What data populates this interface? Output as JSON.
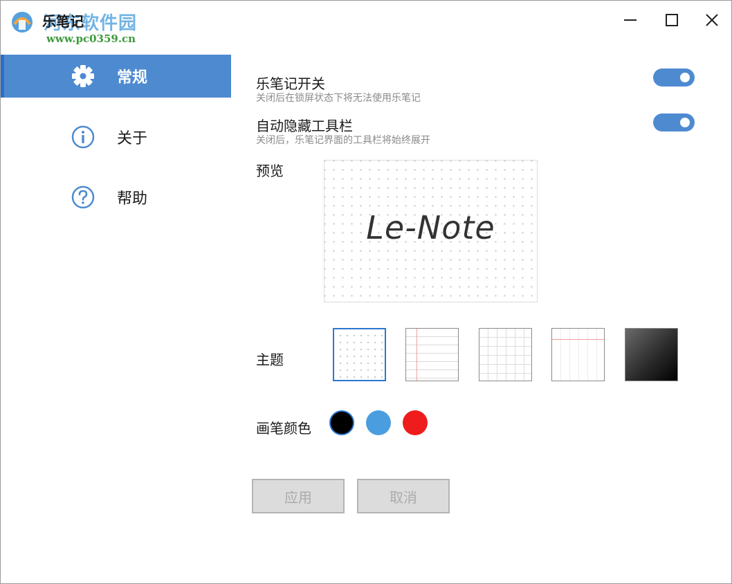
{
  "window": {
    "title": "乐笔记",
    "watermark": {
      "brand": "河东软件园",
      "url": "www.pc0359.cn"
    }
  },
  "sidebar": {
    "items": [
      {
        "label": "常规",
        "icon": "gear-icon",
        "active": true
      },
      {
        "label": "关于",
        "icon": "info-icon",
        "active": false
      },
      {
        "label": "帮助",
        "icon": "help-icon",
        "active": false
      }
    ]
  },
  "settings": {
    "note_switch": {
      "title": "乐笔记开关",
      "description": "关闭后在锁屏状态下将无法使用乐笔记",
      "enabled": true
    },
    "auto_hide_toolbar": {
      "title": "自动隐藏工具栏",
      "description": "关闭后，乐笔记界面的工具栏将始终展开",
      "enabled": true
    }
  },
  "preview": {
    "label": "预览",
    "sample_text": "Le-Note"
  },
  "theme": {
    "label": "主题",
    "options": [
      "dot-grid",
      "lined",
      "square-grid",
      "columns",
      "dark"
    ],
    "selected": "dot-grid"
  },
  "pen_color": {
    "label": "画笔颜色",
    "options": [
      "#000000",
      "#4a9ee0",
      "#ee1c1c"
    ],
    "selected": "#000000"
  },
  "actions": {
    "apply": "应用",
    "cancel": "取消"
  },
  "colors": {
    "accent": "#4e8ad0",
    "toggle_on": "#4e8ad0",
    "button_disabled": "#dcdcdc"
  }
}
